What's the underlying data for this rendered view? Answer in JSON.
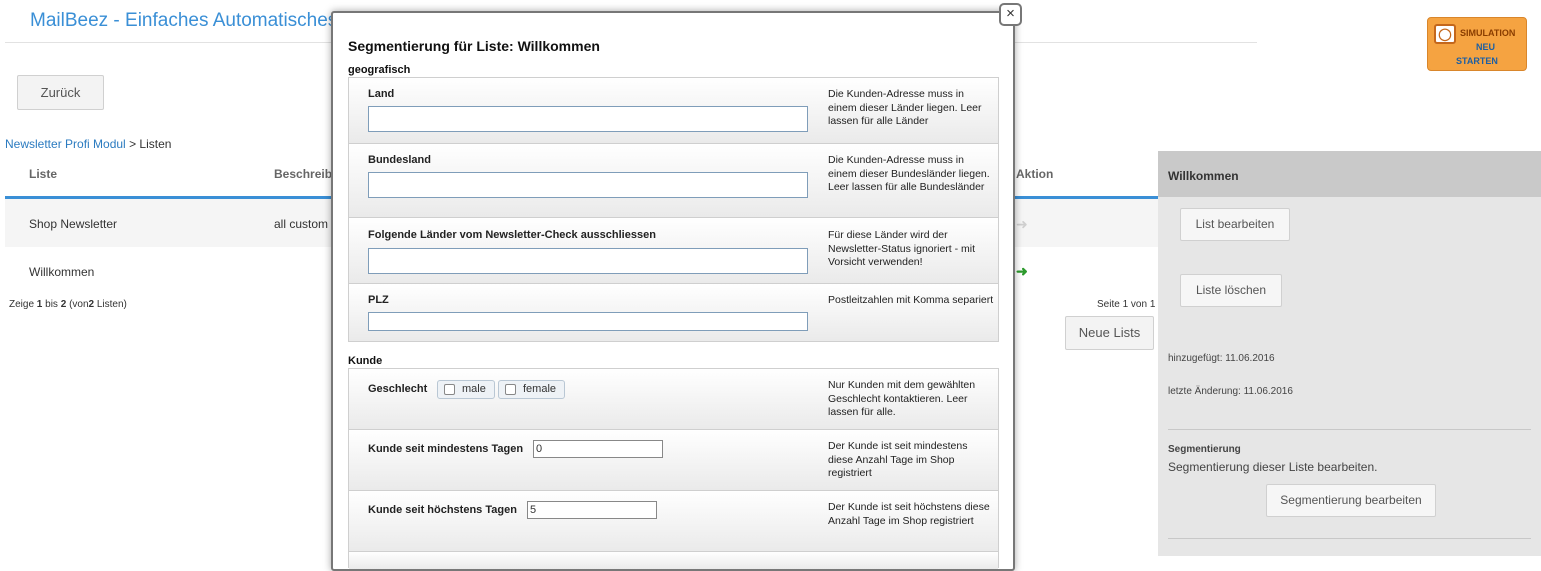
{
  "page": {
    "title": "MailBeez - Einfaches Automatisches E",
    "back_button": "Zurück",
    "breadcrumb": {
      "link": "Newsletter Profi Modul",
      "current": "> Listen"
    },
    "simulation": {
      "line1": "SIMULATION",
      "line2": "NEU",
      "line3": "STARTEN"
    }
  },
  "table": {
    "headers": {
      "list": "Liste",
      "description": "Beschreibu",
      "action": "Aktion"
    },
    "rows": [
      {
        "name": "Shop Newsletter",
        "description": "all custom"
      },
      {
        "name": "Willkommen",
        "description": ""
      }
    ],
    "paging_left": {
      "prefix": "Zeige",
      "from": "1",
      "mid": "bis",
      "to": "2",
      "tail_a": "(von",
      "total": "2",
      "tail_b": "Listen)"
    },
    "paging_right": "Seite 1 von 1",
    "new_list_button": "Neue Lists"
  },
  "panel": {
    "title": "Willkommen",
    "edit_button": "List bearbeiten",
    "delete_button": "Liste löschen",
    "added": "hinzugefügt: 11.06.2016",
    "changed": "letzte Änderung: 11.06.2016",
    "segment_title": "Segmentierung",
    "segment_text": "Segmentierung dieser Liste bearbeiten.",
    "segment_button": "Segmentierung bearbeiten"
  },
  "modal": {
    "close": "×",
    "title": "Segmentierung für Liste: Willkommen",
    "geo": {
      "section": "geografisch",
      "land": {
        "label": "Land",
        "value": "",
        "desc": "Die Kunden-Adresse muss in einem dieser Länder liegen. Leer lassen für alle Länder"
      },
      "state": {
        "label": "Bundesland",
        "value": "",
        "desc": "Die Kunden-Adresse muss in einem dieser Bundesländer liegen. Leer lassen für alle Bundesländer"
      },
      "exclude": {
        "label": "Folgende Länder vom Newsletter-Check ausschliessen",
        "value": "",
        "desc": "Für diese Länder wird der Newsletter-Status ignoriert - mit Vorsicht verwenden!"
      },
      "plz": {
        "label": "PLZ",
        "value": "",
        "desc": "Postleitzahlen mit Komma separiert"
      }
    },
    "customer": {
      "section": "Kunde",
      "gender": {
        "label": "Geschlecht",
        "male": "male",
        "female": "female",
        "desc": "Nur Kunden mit dem gewählten Geschlecht kontaktieren. Leer lassen für alle."
      },
      "min_days": {
        "label": "Kunde seit mindestens Tagen",
        "value": "0",
        "desc": "Der Kunde ist seit mindestens diese Anzahl Tage im Shop registriert"
      },
      "max_days": {
        "label": "Kunde seit höchstens Tagen",
        "value": "5",
        "desc": "Der Kunde ist seit höchstens diese Anzahl Tage im Shop registriert"
      }
    }
  }
}
